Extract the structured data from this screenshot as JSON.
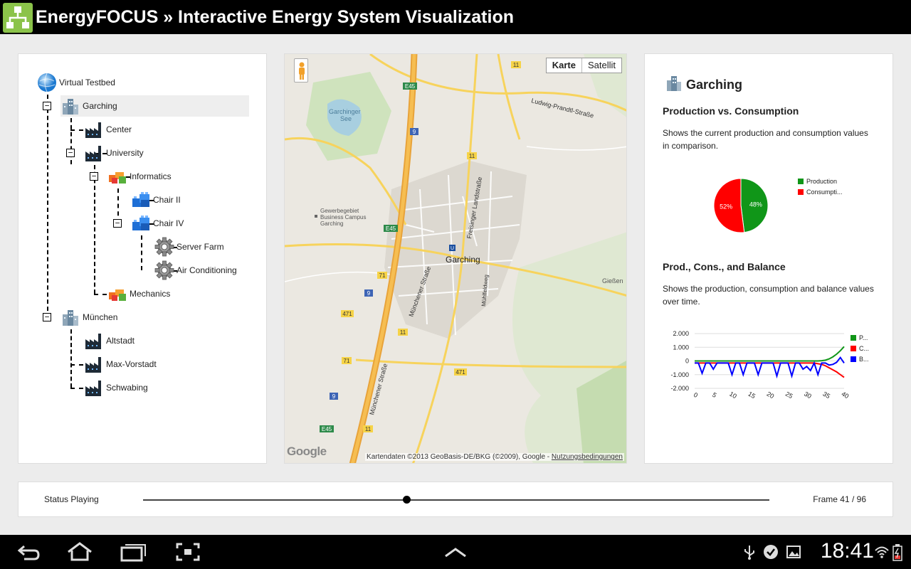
{
  "app": {
    "title": "EnergyFOCUS » Interactive Energy System Visualization",
    "accent_color": "#8bc34a"
  },
  "tree": {
    "nodes": [
      {
        "label": "Virtual Testbed",
        "icon": "globe-icon"
      },
      {
        "label": "Garching",
        "icon": "city-icon",
        "selected": true
      },
      {
        "label": "Center",
        "icon": "factory-icon"
      },
      {
        "label": "University",
        "icon": "factory-icon"
      },
      {
        "label": "Informatics",
        "icon": "building-blocks-icon"
      },
      {
        "label": "Chair II",
        "icon": "blue-blocks-icon"
      },
      {
        "label": "Chair IV",
        "icon": "blue-blocks-icon"
      },
      {
        "label": "Server Farm",
        "icon": "gear-icon"
      },
      {
        "label": "Air Conditioning",
        "icon": "gear-icon"
      },
      {
        "label": "Mechanics",
        "icon": "building-blocks-icon"
      },
      {
        "label": "München",
        "icon": "city-icon"
      },
      {
        "label": "Altstadt",
        "icon": "factory-icon"
      },
      {
        "label": "Max-Vorstadt",
        "icon": "factory-icon"
      },
      {
        "label": "Schwabing",
        "icon": "factory-icon"
      }
    ],
    "toggle_symbol": "−"
  },
  "map": {
    "tabs": [
      {
        "label": "Karte",
        "active": true
      },
      {
        "label": "Satellit",
        "active": false
      }
    ],
    "labels": {
      "garching": "Garching",
      "garchinger_see_1": "Garchinger",
      "garchinger_see_2": "See",
      "gewerbe_1": "Gewerbegebiet",
      "gewerbe_2": "Business Campus",
      "gewerbe_3": "Garching",
      "ludwig": "Ludwig-Prandtl-Straße",
      "freisinger": "Freisinger Landstraße",
      "muenchener1": "Münchener Straße",
      "muenchener2": "Münchener Straße",
      "muehlfeld": "Mühlfeldweg",
      "giessen": "Gießen",
      "ubahn": "U",
      "e45": "E45",
      "r9": "9",
      "r11": "11",
      "r71": "71",
      "r471": "471"
    },
    "attribution": "Kartendaten ©2013 GeoBasis-DE/BKG (©2009), Google - ",
    "terms": "Nutzungsbedingungen",
    "logo": "Google"
  },
  "stats": {
    "title": "Garching",
    "section1": {
      "title": "Production vs. Consumption",
      "desc": "Shows the current production and consumption values in comparison."
    },
    "section2": {
      "title": "Prod., Cons., and Balance",
      "desc": "Shows the production, consumption and balance values over time."
    }
  },
  "chart_data": [
    {
      "type": "pie",
      "slices": [
        {
          "label": "Production",
          "value": 48,
          "text": "48%",
          "color": "#109618"
        },
        {
          "label": "Consumpti...",
          "value": 52,
          "text": "52%",
          "color": "#ff0000"
        }
      ]
    },
    {
      "type": "line",
      "ylim": [
        -2000,
        2000
      ],
      "yticks": [
        "2.000",
        "1.000",
        "0",
        "-1.000",
        "-2.000"
      ],
      "ytick_values": [
        2000,
        1000,
        0,
        -1000,
        -2000
      ],
      "xticks": [
        "0",
        "5",
        "10",
        "15",
        "20",
        "25",
        "30",
        "35",
        "40"
      ],
      "xtick_values": [
        0,
        5,
        10,
        15,
        20,
        25,
        30,
        35,
        40
      ],
      "series": [
        {
          "name": "P...",
          "color": "#109618",
          "values": [
            0,
            0,
            0,
            0,
            0,
            0,
            0,
            0,
            0,
            0,
            0,
            0,
            0,
            0,
            0,
            0,
            0,
            0,
            0,
            0,
            0,
            0,
            0,
            0,
            0,
            0,
            0,
            0,
            0,
            0,
            0,
            0,
            0,
            0,
            20,
            60,
            150,
            300,
            500,
            750,
            1050
          ]
        },
        {
          "name": "C...",
          "color": "#ff0000",
          "values": [
            -150,
            -150,
            -150,
            -150,
            -150,
            -150,
            -150,
            -150,
            -150,
            -150,
            -150,
            -150,
            -150,
            -150,
            -150,
            -150,
            -150,
            -150,
            -150,
            -150,
            -150,
            -150,
            -150,
            -150,
            -150,
            -150,
            -150,
            -150,
            -150,
            -150,
            -150,
            -150,
            -150,
            -200,
            -250,
            -350,
            -500,
            -650,
            -800,
            -1000,
            -1200
          ]
        },
        {
          "name": "B...",
          "color": "#0000ff",
          "values": [
            -150,
            -150,
            -900,
            -150,
            -150,
            -600,
            -150,
            -150,
            -150,
            -150,
            -1000,
            -150,
            -150,
            -1000,
            -150,
            -150,
            -150,
            -1000,
            -150,
            -150,
            -150,
            -150,
            -1100,
            -150,
            -150,
            -150,
            -1100,
            -150,
            -150,
            -600,
            -400,
            -700,
            -150,
            -1000,
            -150,
            -150,
            -300,
            -250,
            -100,
            250,
            -150
          ]
        }
      ]
    }
  ],
  "status": {
    "label": "Status Playing",
    "frame": "Frame 41 / 96",
    "progress": 0.4211
  },
  "system": {
    "clock": "18:41"
  }
}
